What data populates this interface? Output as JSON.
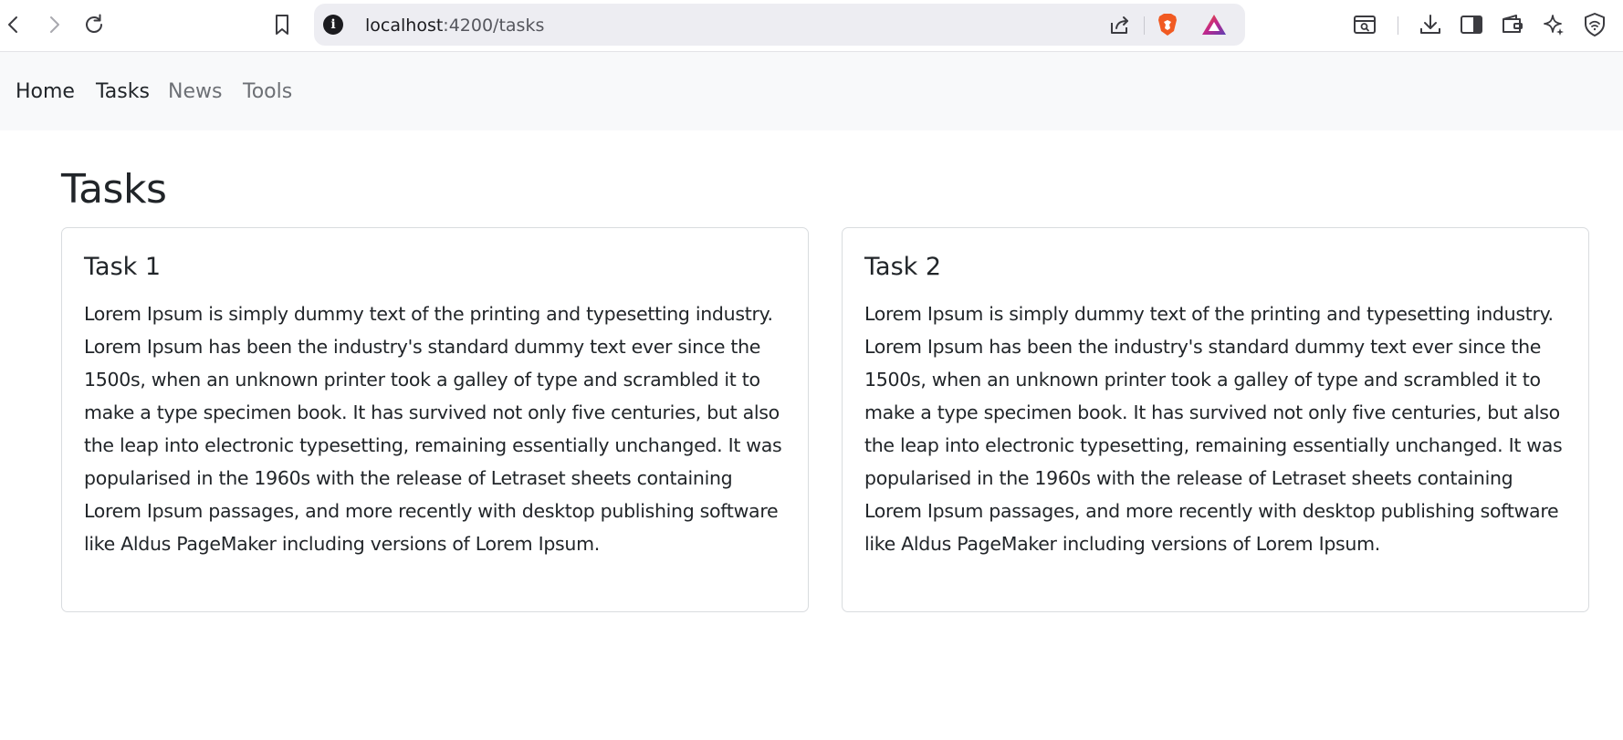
{
  "browser": {
    "url_host": "localhost",
    "url_path": ":4200/tasks",
    "icons": [
      "back-icon",
      "forward-icon",
      "reload-icon",
      "bookmark-icon",
      "site-info-icon",
      "share-icon",
      "brave-shields-icon",
      "brave-rewards-icon",
      "tab-search-icon",
      "downloads-icon",
      "sidebar-icon",
      "wallet-icon",
      "leo-ai-icon",
      "vpn-icon"
    ],
    "colors": {
      "toolbar_bg": "#ffffff",
      "urlbar_bg": "#ededf2",
      "brave_orange": "#f15a22",
      "rewards_purple": "#7b3fa3"
    }
  },
  "nav": {
    "items": [
      {
        "label": "Home",
        "state": "active"
      },
      {
        "label": "Tasks",
        "state": "active"
      },
      {
        "label": "News",
        "state": "muted"
      },
      {
        "label": "Tools",
        "state": "muted"
      }
    ]
  },
  "page": {
    "title": "Tasks",
    "cards": [
      {
        "title": "Task 1",
        "body": "Lorem Ipsum is simply dummy text of the printing and typesetting industry. Lorem Ipsum has been the industry's standard dummy text ever since the 1500s, when an unknown printer took a galley of type and scrambled it to make a type specimen book. It has survived not only five centuries, but also the leap into electronic typesetting, remaining essentially unchanged. It was popularised in the 1960s with the release of Letraset sheets containing Lorem Ipsum passages, and more recently with desktop publishing software like Aldus PageMaker including versions of Lorem Ipsum."
      },
      {
        "title": "Task 2",
        "body": "Lorem Ipsum is simply dummy text of the printing and typesetting industry. Lorem Ipsum has been the industry's standard dummy text ever since the 1500s, when an unknown printer took a galley of type and scrambled it to make a type specimen book. It has survived not only five centuries, but also the leap into electronic typesetting, remaining essentially unchanged. It was popularised in the 1960s with the release of Letraset sheets containing Lorem Ipsum passages, and more recently with desktop publishing software like Aldus PageMaker including versions of Lorem Ipsum."
      }
    ]
  }
}
